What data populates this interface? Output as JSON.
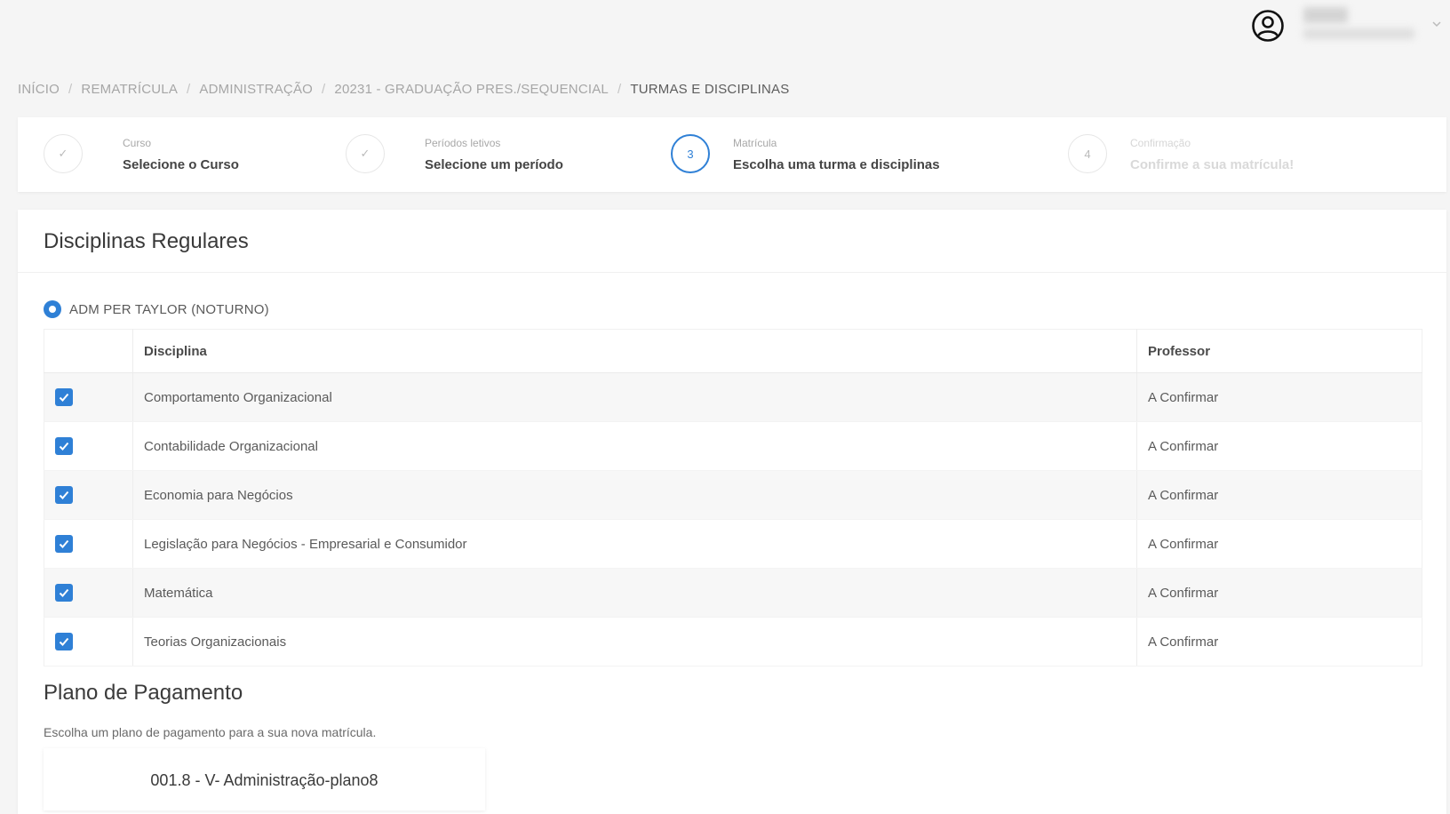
{
  "header": {
    "user_icon": "user-circle-icon",
    "chevron_icon": "chevron-down-icon"
  },
  "breadcrumb": {
    "items": [
      "INÍCIO",
      "REMATRÍCULA",
      "ADMINISTRAÇÃO",
      "20231 - GRADUAÇÃO PRES./SEQUENCIAL",
      "TURMAS E DISCIPLINAS"
    ],
    "separator": "/"
  },
  "stepper": {
    "steps": [
      {
        "small": "Curso",
        "main": "Selecione o Curso",
        "state": "done",
        "marker": "✓"
      },
      {
        "small": "Períodos letivos",
        "main": "Selecione um período",
        "state": "done",
        "marker": "✓"
      },
      {
        "small": "Matrícula",
        "main": "Escolha uma turma e disciplinas",
        "state": "active",
        "marker": "3"
      },
      {
        "small": "Confirmação",
        "main": "Confirme a sua matrícula!",
        "state": "disabled",
        "marker": "4"
      }
    ]
  },
  "regular": {
    "title": "Disciplinas Regulares",
    "class_option": "ADM PER TAYLOR (NOTURNO)",
    "columns": {
      "discipline": "Disciplina",
      "professor": "Professor"
    },
    "rows": [
      {
        "discipline": "Comportamento Organizacional",
        "professor": "A Confirmar",
        "checked": true
      },
      {
        "discipline": "Contabilidade Organizacional",
        "professor": "A Confirmar",
        "checked": true
      },
      {
        "discipline": "Economia para Negócios",
        "professor": "A Confirmar",
        "checked": true
      },
      {
        "discipline": "Legislação para Negócios - Empresarial e Consumidor",
        "professor": "A Confirmar",
        "checked": true
      },
      {
        "discipline": "Matemática",
        "professor": "A Confirmar",
        "checked": true
      },
      {
        "discipline": "Teorias Organizacionais",
        "professor": "A Confirmar",
        "checked": true
      }
    ]
  },
  "payment": {
    "title": "Plano de Pagamento",
    "description": "Escolha um plano de pagamento para a sua nova matrícula.",
    "plan": "001.8 - V- Administração-plano8"
  },
  "colors": {
    "accent": "#2f80d6"
  }
}
